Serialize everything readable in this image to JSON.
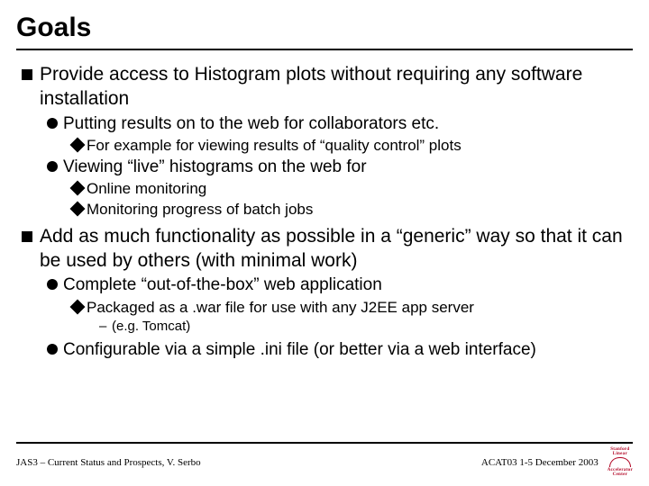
{
  "title": "Goals",
  "bullets": {
    "b1": "Provide access to Histogram plots without requiring any software installation",
    "b1_1": "Putting results on to the web for collaborators etc.",
    "b1_1_1": "For example for viewing results of “quality control” plots",
    "b1_2": "Viewing “live” histograms on the web for",
    "b1_2_1": "Online monitoring",
    "b1_2_2": "Monitoring progress of batch jobs",
    "b2": "Add as much functionality as possible in a “generic” way so that it can be used by others (with minimal work)",
    "b2_1": "Complete “out-of-the-box” web application",
    "b2_1_1": "Packaged as a .war file for use with any J2EE app server",
    "b2_1_1_1": "(e.g. Tomcat)",
    "b2_2": "Configurable via a simple .ini file (or better via a web interface)"
  },
  "footer": {
    "left": "JAS3 – Current Status and Prospects,  V. Serbo",
    "right": "ACAT03    1-5 December 2003",
    "logo": {
      "l1": "Stanford",
      "l2": "Linear",
      "l3": "Accelerator",
      "l4": "Center"
    }
  }
}
